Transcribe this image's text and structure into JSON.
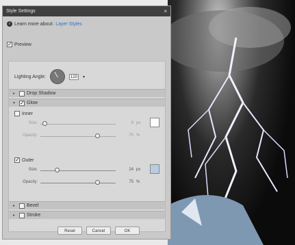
{
  "dialog": {
    "title": "Style Settings",
    "close_glyph": "×",
    "learn_prefix": "Learn more about:",
    "learn_link": "Layer Styles",
    "preview_label": "Preview"
  },
  "lighting": {
    "label": "Lighting Angle:",
    "value": "120",
    "dropdown_glyph": "▾"
  },
  "sections": {
    "drop_shadow": "Drop Shadow",
    "glow": "Glow",
    "bevel": "Bevel",
    "stroke": "Stroke"
  },
  "inner": {
    "label": "Inner",
    "size_label": "Size:",
    "size_value": "9",
    "size_unit": "px",
    "size_fraction": 0.05,
    "opacity_label": "Opacity:",
    "opacity_value": "75",
    "opacity_unit": "%",
    "opacity_fraction": 0.75,
    "color": "#ffffff"
  },
  "outer": {
    "label": "Outer",
    "size_label": "Size:",
    "size_value": "24",
    "size_unit": "px",
    "size_fraction": 0.22,
    "opacity_label": "Opacity:",
    "opacity_value": "75",
    "opacity_unit": "%",
    "opacity_fraction": 0.75,
    "color": "#b9cde0"
  },
  "buttons": {
    "reset": "Reset",
    "cancel": "Cancel",
    "ok": "OK"
  },
  "colors": {
    "titlebar": "#3f3f3f",
    "link": "#2a73c9"
  }
}
